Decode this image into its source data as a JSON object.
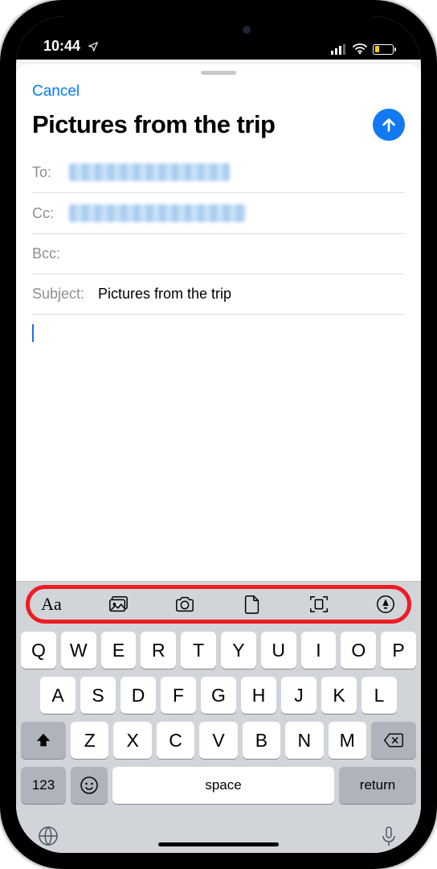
{
  "status": {
    "time": "10:44"
  },
  "compose": {
    "cancel": "Cancel",
    "title": "Pictures from the trip",
    "to_label": "To:",
    "cc_label": "Cc:",
    "bcc_label": "Bcc:",
    "subject_label": "Subject:",
    "subject_value": "Pictures from the trip"
  },
  "toolbar": {
    "format": "Aa"
  },
  "keyboard": {
    "row1": [
      "Q",
      "W",
      "E",
      "R",
      "T",
      "Y",
      "U",
      "I",
      "O",
      "P"
    ],
    "row2": [
      "A",
      "S",
      "D",
      "F",
      "G",
      "H",
      "J",
      "K",
      "L"
    ],
    "row3": [
      "Z",
      "X",
      "C",
      "V",
      "B",
      "N",
      "M"
    ],
    "numKey": "123",
    "space": "space",
    "return": "return"
  }
}
